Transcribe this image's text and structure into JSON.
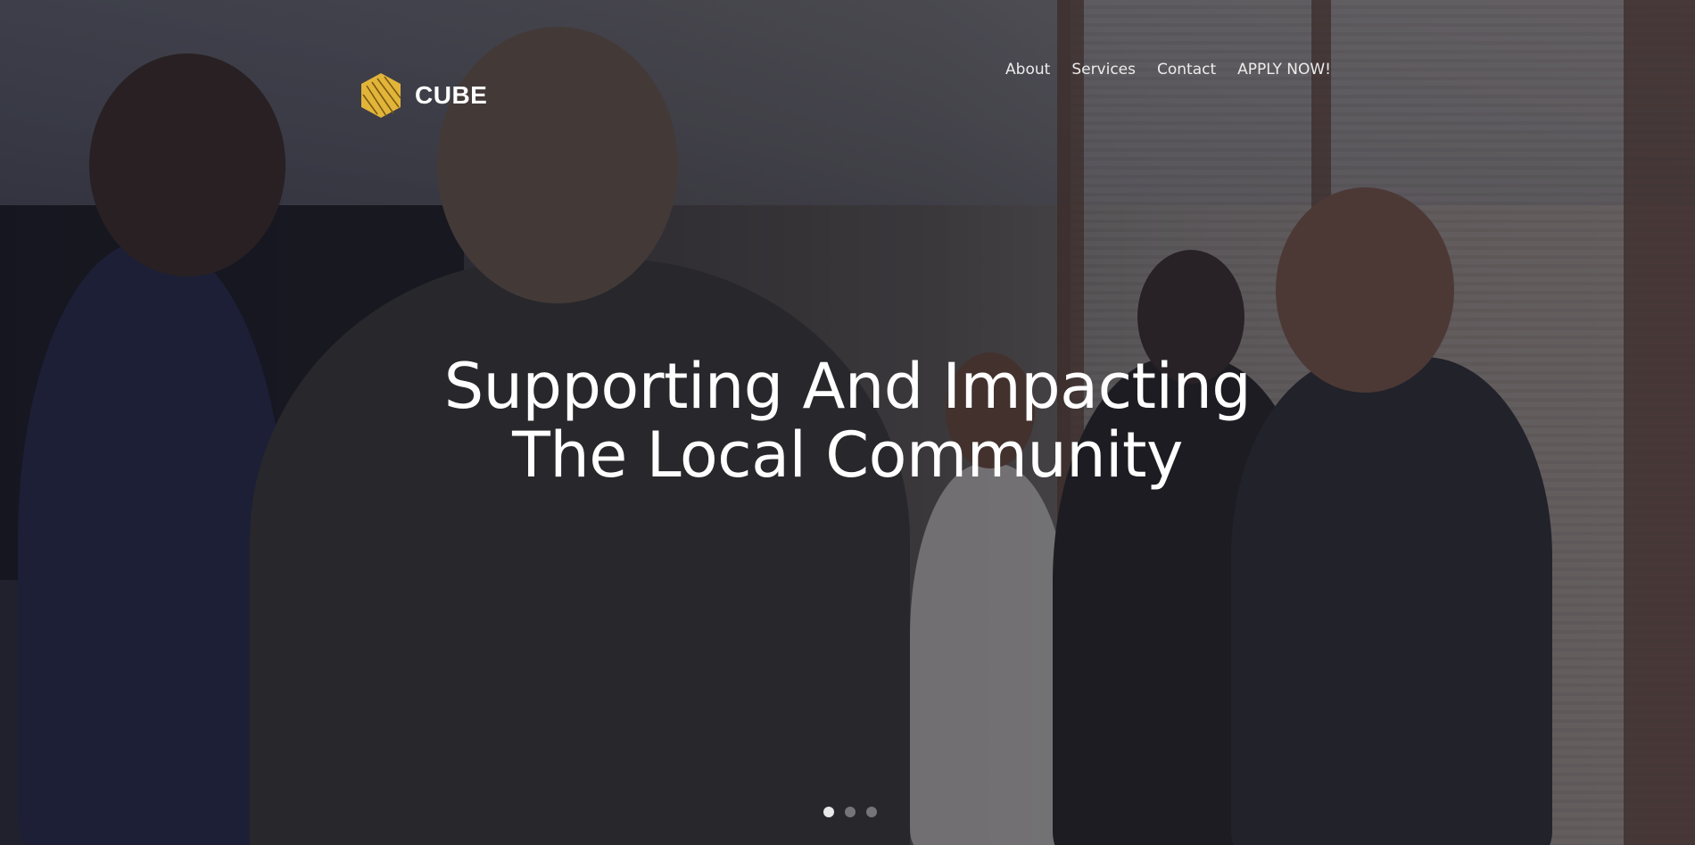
{
  "brand": {
    "name": "CUBE",
    "logo_icon": "cube-icon",
    "accent_color": "#e2b53a"
  },
  "nav": {
    "items": [
      {
        "label": "About"
      },
      {
        "label": "Services"
      },
      {
        "label": "Contact"
      },
      {
        "label": "APPLY NOW!"
      }
    ]
  },
  "hero": {
    "headline_line1": "Supporting And Impacting",
    "headline_line2": "The Local Community"
  },
  "carousel": {
    "slide_count": 3,
    "active_index": 0
  }
}
